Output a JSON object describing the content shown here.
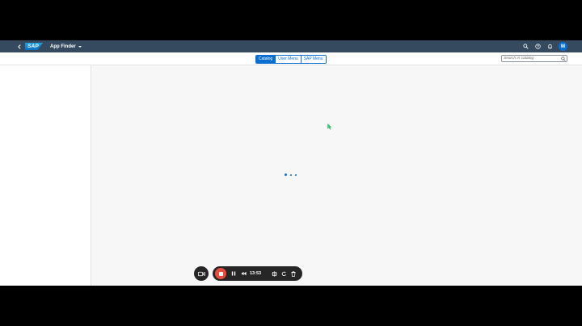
{
  "shell": {
    "logo_text": "SAP",
    "app_title": "App Finder",
    "avatar_initial": "M"
  },
  "tabs": [
    {
      "label": "Catalog",
      "active": true
    },
    {
      "label": "User Menu",
      "active": false
    },
    {
      "label": "SAP Menu",
      "active": false
    }
  ],
  "search": {
    "placeholder": "Search in catalog"
  },
  "recorder": {
    "timer": "13:53"
  },
  "colors": {
    "shellbar": "#354a5f",
    "accent": "#0a6ed1",
    "record_stop": "#e74c3c",
    "cursor": "#2ecc71"
  },
  "icons": [
    "back-icon",
    "search-icon",
    "help-icon",
    "bell-icon",
    "camera-icon",
    "stop-icon",
    "pause-icon",
    "rewind-icon",
    "crosshair-icon",
    "restart-icon",
    "trash-icon",
    "cursor-icon"
  ]
}
